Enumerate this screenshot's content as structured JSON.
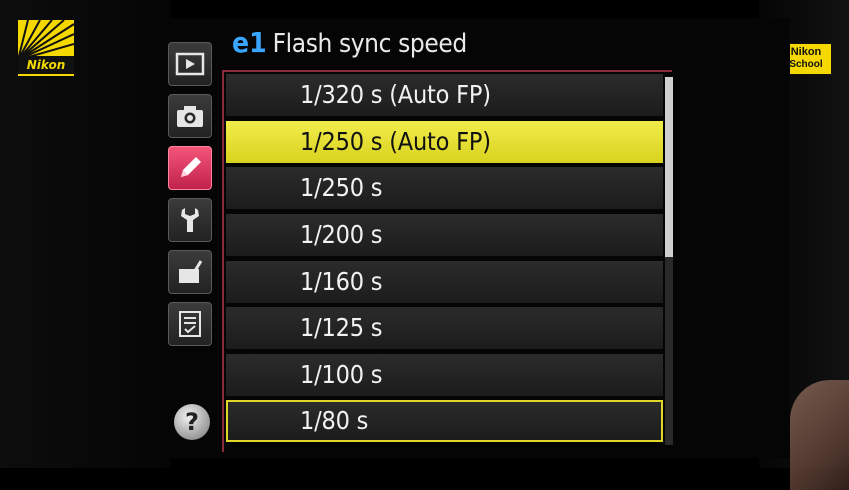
{
  "brand": {
    "logo_text": "Nikon",
    "school_badge": {
      "line1": "Nikon",
      "line2": "School"
    }
  },
  "header": {
    "code": "e1",
    "title": "Flash sync speed"
  },
  "tabs": [
    {
      "name": "playback",
      "icon": "play-icon"
    },
    {
      "name": "shooting",
      "icon": "camera-icon"
    },
    {
      "name": "custom-settings",
      "icon": "pencil-icon",
      "active": true
    },
    {
      "name": "setup",
      "icon": "wrench-icon"
    },
    {
      "name": "retouch",
      "icon": "retouch-icon"
    },
    {
      "name": "my-menu",
      "icon": "checklist-icon"
    }
  ],
  "help": {
    "glyph": "?"
  },
  "options": [
    {
      "label": "1/320 s (Auto FP)"
    },
    {
      "label": "1/250 s (Auto FP)",
      "state": "selected"
    },
    {
      "label": "1/250 s"
    },
    {
      "label": "1/200 s"
    },
    {
      "label": "1/160 s"
    },
    {
      "label": "1/125 s"
    },
    {
      "label": "1/100 s"
    },
    {
      "label": "1/80 s",
      "state": "outlined"
    }
  ],
  "colors": {
    "highlight": "#e6e030",
    "active_tab": "#d9335f",
    "code_blue": "#3aa6ff"
  }
}
